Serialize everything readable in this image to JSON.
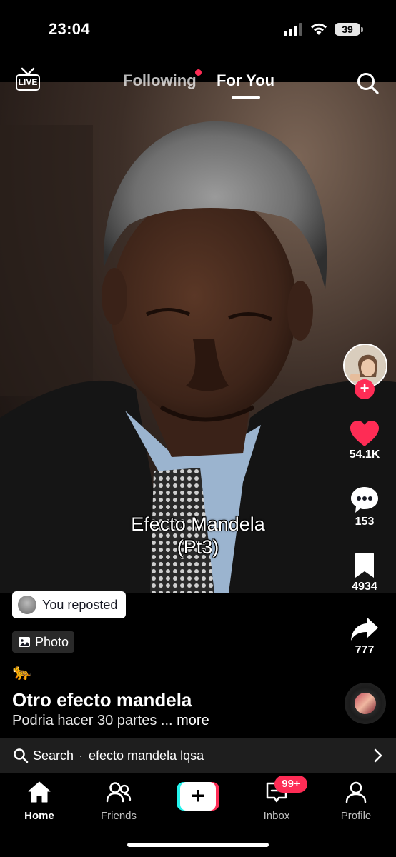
{
  "status_bar": {
    "time": "23:04",
    "battery": "39"
  },
  "top_nav": {
    "live_label": "LIVE",
    "tabs": [
      {
        "label": "Following",
        "has_dot": true,
        "active": false
      },
      {
        "label": "For You",
        "active": true
      }
    ],
    "search_icon": "search-icon"
  },
  "media": {
    "type": "photo",
    "overlay_text_line1": "Efecto Mandela",
    "overlay_text_line2": "(Pt3)"
  },
  "actions": {
    "like_count": "54.1K",
    "comment_count": "153",
    "save_count": "4934",
    "share_count": "777",
    "follow_symbol": "+"
  },
  "post": {
    "reposted_label": "You reposted",
    "media_badge": "Photo",
    "emoji": "🐆",
    "title": "Otro efecto mandela",
    "description": "Podria hacer 30 partes ...",
    "more_label": "more"
  },
  "search_bar": {
    "label": "Search",
    "separator": "·",
    "query": "efecto mandela lqsa"
  },
  "bottom_nav": {
    "items": [
      {
        "label": "Home",
        "active": true
      },
      {
        "label": "Friends",
        "active": false
      },
      {
        "label": "",
        "create": true
      },
      {
        "label": "Inbox",
        "active": false,
        "badge": "99+"
      },
      {
        "label": "Profile",
        "active": false
      }
    ],
    "create_symbol": "+"
  },
  "colors": {
    "accent_red": "#fe2c55",
    "accent_cyan": "#25f4ee",
    "background": "#000000",
    "search_bar_bg": "#1e1e1e"
  }
}
